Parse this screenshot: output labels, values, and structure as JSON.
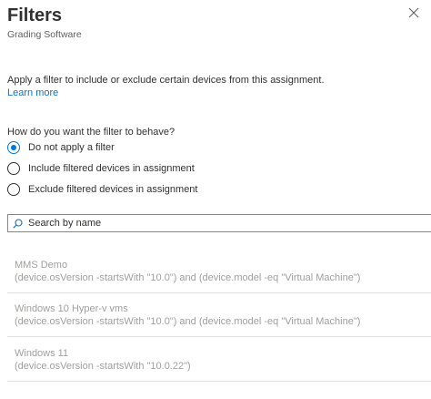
{
  "panel": {
    "title": "Filters",
    "subtitle": "Grading Software"
  },
  "description": "Apply a filter to include or exclude certain devices from this assignment.",
  "learn_more": "Learn more",
  "question": "How do you want the filter to behave?",
  "options": [
    {
      "label": "Do not apply a filter",
      "selected": true
    },
    {
      "label": "Include filtered devices in assignment",
      "selected": false
    },
    {
      "label": "Exclude filtered devices in assignment",
      "selected": false
    }
  ],
  "search": {
    "placeholder": "Search by name",
    "value": ""
  },
  "filters": [
    {
      "name": "MMS Demo",
      "rule": "(device.osVersion -startsWith \"10.0\") and (device.model -eq \"Virtual Machine\")"
    },
    {
      "name": "Windows 10 Hyper-v vms",
      "rule": "(device.osVersion -startsWith \"10.0\") and (device.model -eq \"Virtual Machine\")"
    },
    {
      "name": "Windows 11",
      "rule": "(device.osVersion -startsWith \"10.0.22\")"
    }
  ],
  "colors": {
    "accent": "#0078d4",
    "text": "#323130",
    "disabled_text": "#a19f9d",
    "divider": "#e1dfdd"
  }
}
